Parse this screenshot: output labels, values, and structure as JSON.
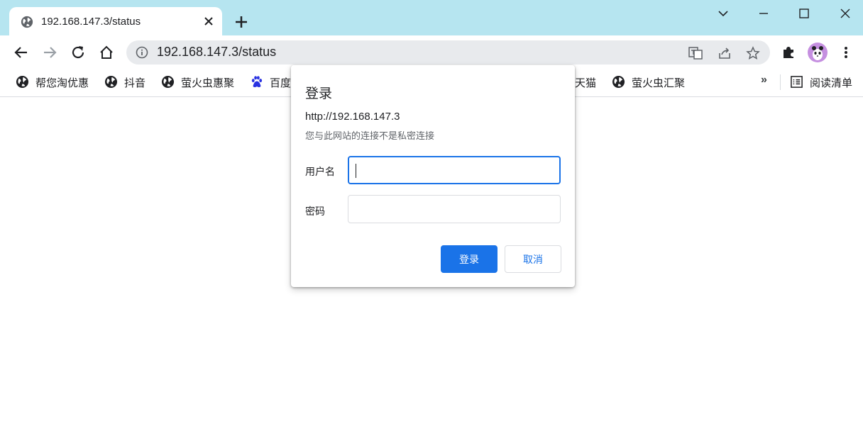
{
  "colors": {
    "tabstrip": "#b6e5f0",
    "accent": "#1a73e8",
    "avatar": "#c58fe0"
  },
  "tab": {
    "title": "192.168.147.3/status",
    "icon": "globe-icon"
  },
  "omnibox": {
    "url": "192.168.147.3/status"
  },
  "bookmarks": {
    "items": [
      {
        "label": "帮您淘优惠",
        "icon": "globe-icon"
      },
      {
        "label": "抖音",
        "icon": "globe-icon"
      },
      {
        "label": "萤火虫惠聚",
        "icon": "globe-icon"
      },
      {
        "label": "百度",
        "icon": "baidu-paw-icon"
      },
      {
        "label": "天猫",
        "icon": ""
      },
      {
        "label": "萤火虫汇聚",
        "icon": "globe-icon"
      }
    ],
    "overflow": "»",
    "reading_list": "阅读清单"
  },
  "dialog": {
    "title": "登录",
    "origin": "http://192.168.147.3",
    "warning": "您与此网站的连接不是私密连接",
    "username_label": "用户名",
    "username_value": "",
    "password_label": "密码",
    "password_value": "",
    "login_button": "登录",
    "cancel_button": "取消"
  }
}
